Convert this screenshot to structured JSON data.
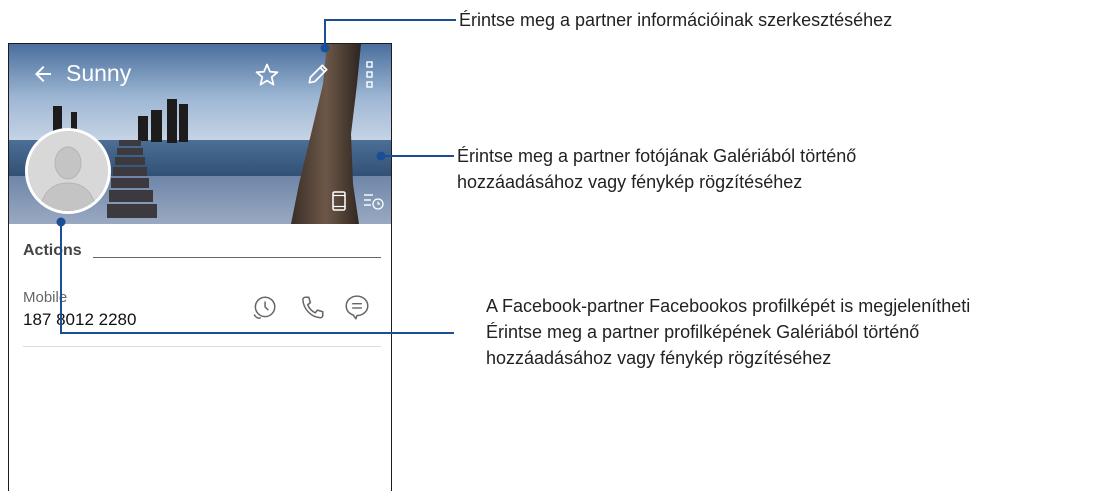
{
  "contact": {
    "name": "Sunny",
    "actions_label": "Actions",
    "mobile_label": "Mobile",
    "mobile_number": "187 8012 2280"
  },
  "icons": [
    "back-arrow-icon",
    "star-icon",
    "edit-pencil-icon",
    "more-vert-icon",
    "avatar-silhouette-icon",
    "phone-device-icon",
    "call-log-icon",
    "history-icon",
    "call-icon",
    "message-icon"
  ],
  "colors": {
    "accent": "#1a4f96",
    "title_text": "#ffffff"
  },
  "callouts": {
    "edit": "Érintse meg a partner információinak szerkesztéséhez",
    "photo_line1": "Érintse meg a partner fotójának Galériából történő",
    "photo_line2": "hozzáadásához vagy fénykép rögzítéséhez",
    "profile_line1": "A Facebook-partner Facebookos profilképét is megjelenítheti",
    "profile_line2": "Érintse meg a partner profilképének Galériából történő",
    "profile_line3": "hozzáadásához vagy fénykép rögzítéséhez"
  }
}
